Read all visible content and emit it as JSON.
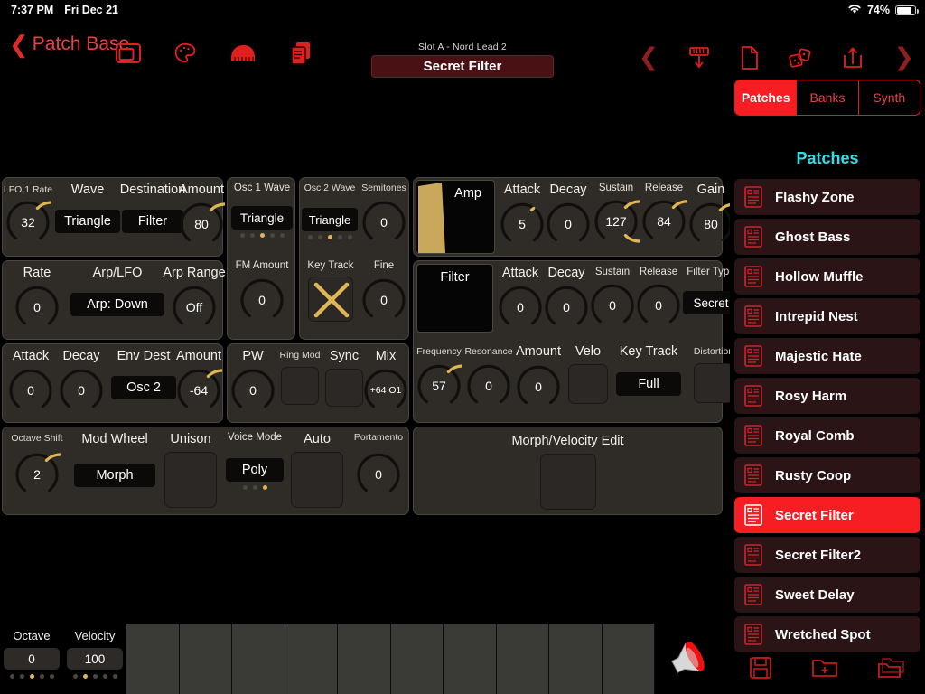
{
  "statusbar": {
    "time": "7:37 PM",
    "date": "Fri Dec 21",
    "battery_pct": "74%",
    "wifi_icon": "wifi-icon",
    "battery_icon": "battery-icon"
  },
  "header": {
    "back_label": "Patch Base",
    "back_icon": "chevron-left-icon",
    "left_icons": [
      "window-icon",
      "palette-icon",
      "piano-icon",
      "documents-icon"
    ],
    "right_icons": [
      "chevron-left-icon",
      "send-to-synth-icon",
      "new-file-icon",
      "randomize-icon",
      "export-icon",
      "chevron-right-icon"
    ],
    "slot_label": "Slot A - Nord Lead 2",
    "patch_name": "Secret Filter"
  },
  "colors": {
    "accent_red": "#f61d23",
    "knob_gold": "#e0b553",
    "cyan": "#2fe0e8",
    "panel_bg": "#2f2c28"
  },
  "editor": {
    "lfo1": {
      "rate": {
        "label": "LFO 1 Rate",
        "value": "32",
        "pct": 0.25
      },
      "wave": {
        "label": "Wave",
        "value": "Triangle"
      },
      "destination": {
        "label": "Destination",
        "value": "Filter"
      },
      "amount": {
        "label": "Amount",
        "value": "80",
        "pct": 0.63
      }
    },
    "lfo2": {
      "rate": {
        "label": "Rate",
        "value": "0",
        "pct": 0
      },
      "arp_lfo": {
        "label": "Arp/LFO",
        "value": "Arp: Down"
      },
      "arp_range": {
        "label": "Arp Range",
        "value": "Off",
        "pct": 0
      }
    },
    "modenv": {
      "attack": {
        "label": "Attack",
        "value": "0",
        "pct": 0
      },
      "decay": {
        "label": "Decay",
        "value": "0",
        "pct": 0
      },
      "env_dest": {
        "label": "Env Dest",
        "value": "Osc 2"
      },
      "amount": {
        "label": "Amount",
        "value": "-64",
        "pct": 0.5
      }
    },
    "osc1": {
      "wave": {
        "label": "Osc 1 Wave",
        "value": "Triangle",
        "dots": 5,
        "dot_on": 3
      },
      "fm_amount": {
        "label": "FM Amount",
        "value": "0",
        "pct": 0
      },
      "pw": {
        "label": "PW",
        "value": "0",
        "pct": 0
      },
      "ring_mod": {
        "label": "Ring Mod",
        "on": false
      },
      "sync": {
        "label": "Sync",
        "on": false
      },
      "mix": {
        "label": "Mix",
        "value": "+64 O1",
        "pct": 0
      }
    },
    "osc2": {
      "wave": {
        "label": "Osc 2 Wave",
        "value": "Triangle",
        "dots": 5,
        "dot_on": 3
      },
      "semitones": {
        "label": "Semitones",
        "value": "0",
        "pct": 0
      },
      "key_track": {
        "label": "Key Track",
        "on": true,
        "mark": "x-mark-icon"
      },
      "fine": {
        "label": "Fine",
        "value": "0",
        "pct": 0
      }
    },
    "amp_env": {
      "title": "Amp",
      "attack": {
        "label": "Attack",
        "value": "5",
        "pct": 0.03
      },
      "decay": {
        "label": "Decay",
        "value": "0",
        "pct": 0
      },
      "sustain": {
        "label": "Sustain",
        "value": "127",
        "pct": 1.0
      },
      "release": {
        "label": "Release",
        "value": "84",
        "pct": 0.66
      },
      "gain": {
        "label": "Gain",
        "value": "80",
        "pct": 0.63
      }
    },
    "filter_env": {
      "title": "Filter",
      "attack": {
        "label": "Attack",
        "value": "0",
        "pct": 0
      },
      "decay": {
        "label": "Decay",
        "value": "0",
        "pct": 0
      },
      "sustain": {
        "label": "Sustain",
        "value": "0",
        "pct": 0
      },
      "release": {
        "label": "Release",
        "value": "0",
        "pct": 0
      },
      "filter_type": {
        "label": "Filter Type",
        "value": "Secret"
      }
    },
    "filter": {
      "frequency": {
        "label": "Frequency",
        "value": "57",
        "pct": 0.45
      },
      "resonance": {
        "label": "Resonance",
        "value": "0",
        "pct": 0
      },
      "amount": {
        "label": "Amount",
        "value": "0",
        "pct": 0
      },
      "velo": {
        "label": "Velo",
        "on": false
      },
      "key_track": {
        "label": "Key Track",
        "value": "Full"
      },
      "distortion": {
        "label": "Distortion",
        "on": false
      }
    },
    "global": {
      "octave_shift": {
        "label": "Octave Shift",
        "value": "2",
        "pct": 0.52
      },
      "mod_wheel": {
        "label": "Mod Wheel",
        "value": "Morph"
      },
      "unison": {
        "label": "Unison",
        "on": false
      },
      "voice_mode": {
        "label": "Voice Mode",
        "value": "Poly",
        "dots": 3,
        "dot_on": 3
      },
      "auto": {
        "label": "Auto",
        "on": false
      },
      "portamento": {
        "label": "Portamento",
        "value": "0",
        "pct": 0
      }
    },
    "morph": {
      "label": "Morph/Velocity Edit"
    }
  },
  "keyboard": {
    "octave": {
      "label": "Octave",
      "value": "0",
      "dots": 5,
      "dot_on": 3
    },
    "velocity": {
      "label": "Velocity",
      "value": "100",
      "dots": 5,
      "dot_on": 2
    },
    "key_count": 10,
    "speaker_icon": "speaker-icon"
  },
  "sidebar": {
    "tabs": [
      {
        "label": "Patches",
        "active": true
      },
      {
        "label": "Banks",
        "active": false
      },
      {
        "label": "Synth",
        "active": false
      }
    ],
    "title": "Patches",
    "patches": [
      {
        "name": "Flashy Zone",
        "selected": false
      },
      {
        "name": "Ghost Bass",
        "selected": false
      },
      {
        "name": "Hollow Muffle",
        "selected": false
      },
      {
        "name": "Intrepid Nest",
        "selected": false
      },
      {
        "name": "Majestic Hate",
        "selected": false
      },
      {
        "name": "Rosy Harm",
        "selected": false
      },
      {
        "name": "Royal Comb",
        "selected": false
      },
      {
        "name": "Rusty Coop",
        "selected": false
      },
      {
        "name": "Secret Filter",
        "selected": true
      },
      {
        "name": "Secret Filter2",
        "selected": false
      },
      {
        "name": "Sweet Delay",
        "selected": false
      },
      {
        "name": "Wretched Spot",
        "selected": false
      }
    ],
    "tools": [
      "save-icon",
      "new-folder-icon",
      "copy-folder-icon"
    ]
  }
}
